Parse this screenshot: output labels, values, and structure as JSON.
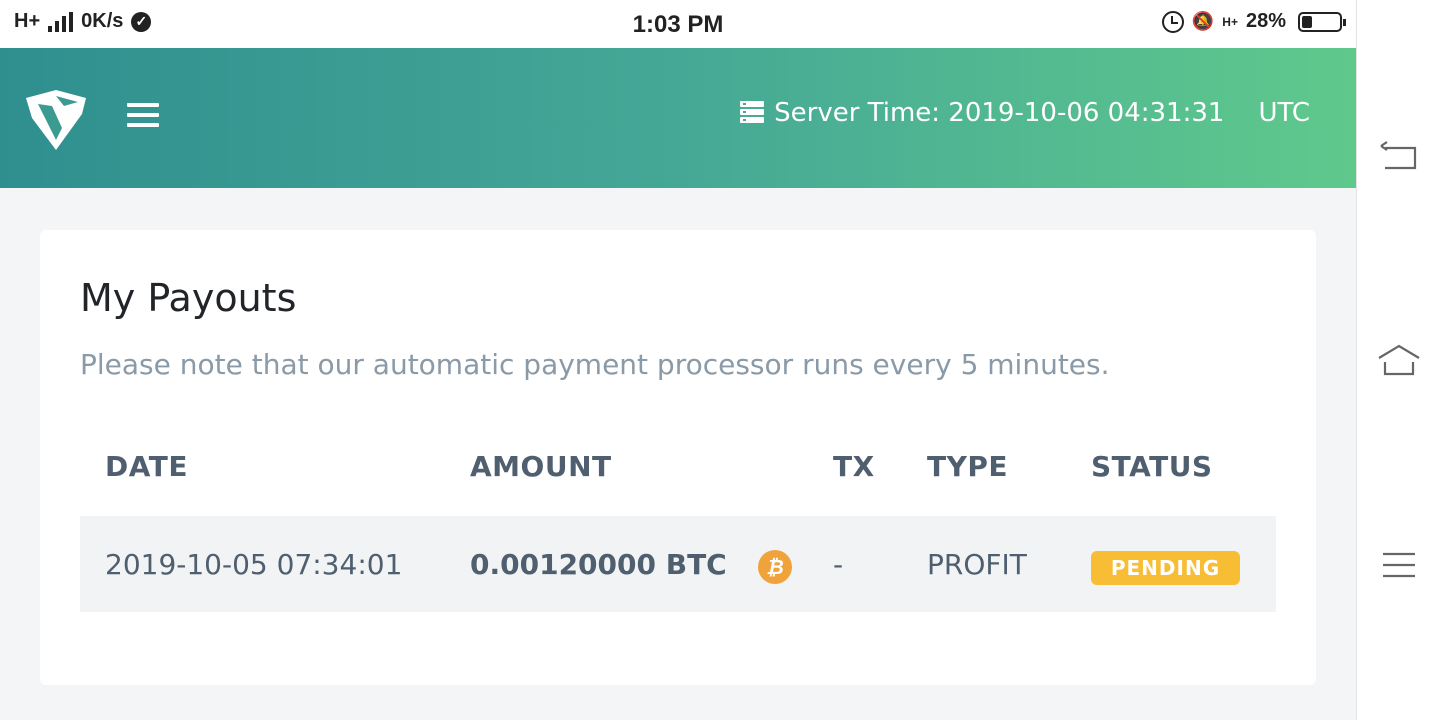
{
  "status_bar": {
    "network": "H+",
    "speed": "0K/s",
    "time": "1:03 PM",
    "network2": "H+",
    "battery": "28%"
  },
  "header": {
    "server_time_label": "Server Time: 2019-10-06 04:31:31",
    "timezone": "UTC",
    "gradient_start": "#2f8f8f",
    "gradient_end": "#5fc98c"
  },
  "page": {
    "title": "My Payouts",
    "note": "Please note that our automatic payment processor runs every 5 minutes."
  },
  "table": {
    "columns": [
      "DATE",
      "AMOUNT",
      "TX",
      "TYPE",
      "STATUS"
    ],
    "rows": [
      {
        "date": "2019-10-05 07:34:01",
        "amount": "0.00120000 BTC",
        "coin_icon": "bitcoin-icon",
        "tx": "-",
        "type": "PROFIT",
        "status": "PENDING"
      }
    ]
  },
  "colors": {
    "badge_pending": "#f7bd35",
    "bitcoin": "#f0a33a"
  }
}
